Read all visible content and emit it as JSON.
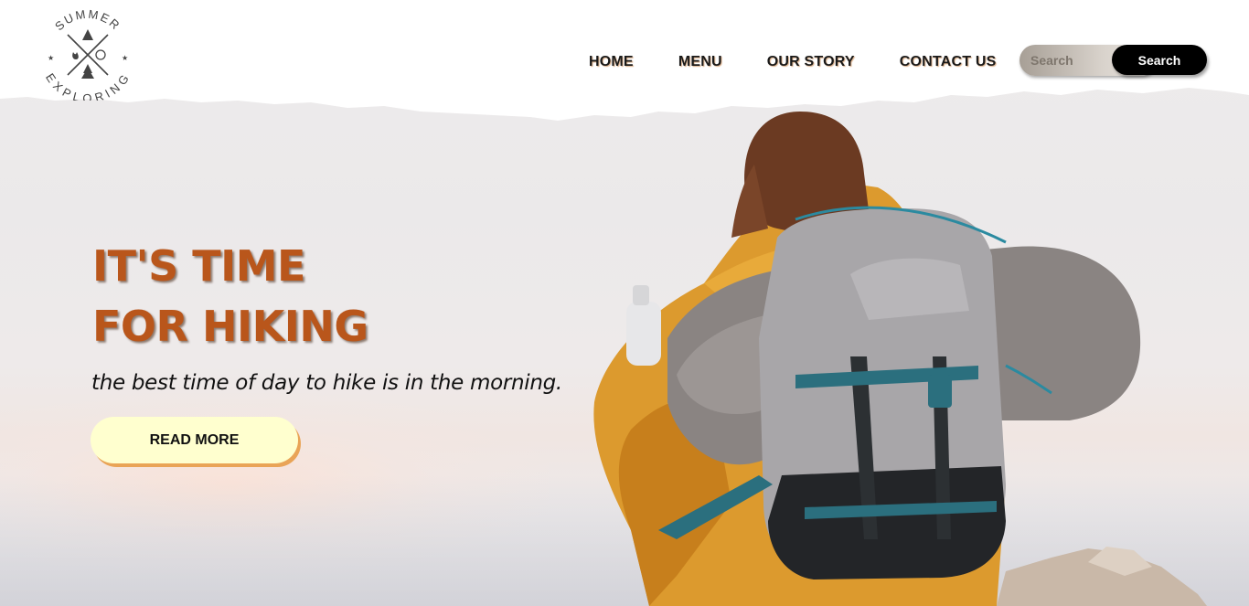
{
  "logo": {
    "top_text": "SUMMER",
    "bottom_text": "EXPLORING",
    "icon": "camping-compass-emblem-icon"
  },
  "nav": {
    "items": [
      {
        "label": "HOME"
      },
      {
        "label": "MENU"
      },
      {
        "label": "OUR STORY"
      },
      {
        "label": "CONTACT US"
      }
    ]
  },
  "search": {
    "placeholder": "Search",
    "button_label": "Search"
  },
  "hero": {
    "title_line1": "IT'S TIME",
    "title_line2": "FOR HIKING",
    "subtitle": "the best time of day to hike is in the morning.",
    "cta_label": "READ MORE",
    "image": "hiker-with-backpack-photo"
  },
  "colors": {
    "title": "#b9561b",
    "cta_background": "#ffffcf",
    "cta_shadow": "#e9a457",
    "search_button": "#000000"
  }
}
